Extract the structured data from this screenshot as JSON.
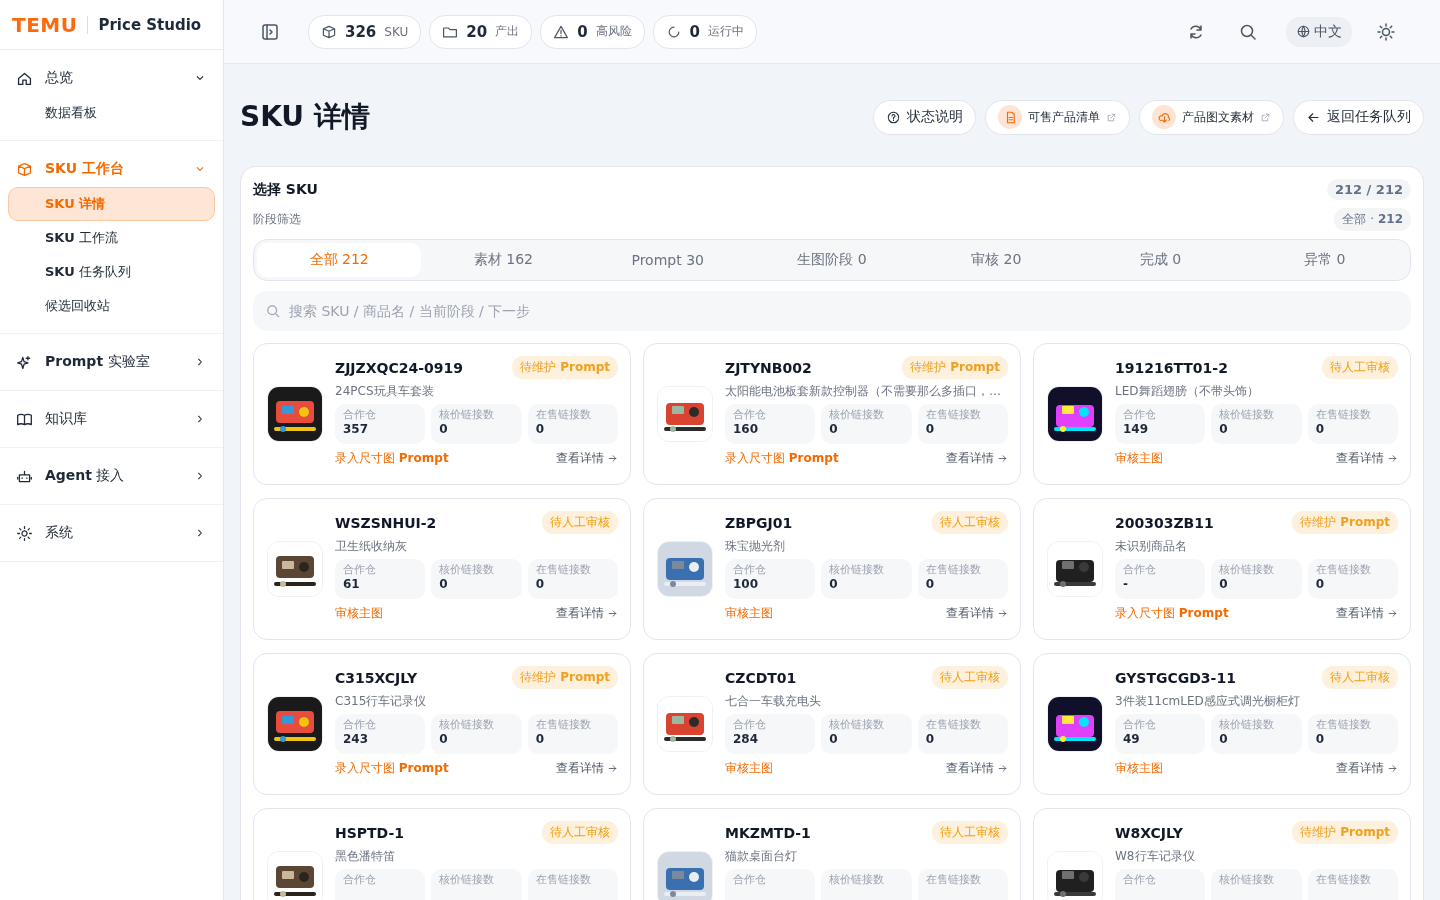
{
  "brand": {
    "logo": "TEMU",
    "product": "Price Studio"
  },
  "sidebar": [
    {
      "label": "总览",
      "expanded": true,
      "selected": false,
      "children": [
        {
          "label": "数据看板",
          "selected": false
        }
      ]
    },
    {
      "label": "SKU 工作台",
      "expanded": true,
      "selected": true,
      "children": [
        {
          "label": "**SKU** 详情",
          "selected": true
        },
        {
          "label": "**SKU** 工作流",
          "selected": false
        },
        {
          "label": "**SKU** 任务队列",
          "selected": false
        },
        {
          "label": "候选回收站",
          "selected": false
        }
      ]
    },
    {
      "label": "**Prompt** 实验室",
      "expanded": false,
      "selected": false
    },
    {
      "label": "知识库",
      "expanded": false,
      "selected": false
    },
    {
      "label": "**Agent** 接入",
      "expanded": false,
      "selected": false
    },
    {
      "label": "系统",
      "expanded": false,
      "selected": false
    }
  ],
  "topbar": {
    "stats": [
      {
        "value": "326",
        "label": "SKU"
      },
      {
        "value": "20",
        "label": "产出"
      },
      {
        "value": "0",
        "label": "高风险"
      },
      {
        "value": "0",
        "label": "运行中"
      }
    ],
    "language": "中文"
  },
  "page": {
    "title": "SKU 详情",
    "actions": [
      {
        "label": "状态说明",
        "external": false
      },
      {
        "label": "可售产品清单",
        "external": true
      },
      {
        "label": "产品图文素材",
        "external": true
      },
      {
        "label": "返回任务队列",
        "external": false
      }
    ]
  },
  "panel": {
    "title": "选择 SKU",
    "count": "212 / 212",
    "filter_label": "阶段筛选",
    "filter_summary": "全部 · **212**",
    "tabs": [
      {
        "label": "全部 212",
        "selected": true
      },
      {
        "label": "素材 162",
        "selected": false
      },
      {
        "label": "Prompt 30",
        "selected": false
      },
      {
        "label": "生图阶段 0",
        "selected": false
      },
      {
        "label": "审核 20",
        "selected": false
      },
      {
        "label": "完成 0",
        "selected": false
      },
      {
        "label": "异常 0",
        "selected": false
      }
    ],
    "search": {
      "placeholder": "搜索 SKU / 商品名 / 当前阶段 / 下一步"
    },
    "cards": [
      {
        "sku": "ZJJZXQC24-0919",
        "name": "24PCS玩具车套装",
        "badge": {
          "kind": "prompt",
          "text": "待维护 **Prompt**"
        },
        "stats": [
          {
            "label": "合作仓",
            "value": "357"
          },
          {
            "label": "核价链接数",
            "value": "0"
          },
          {
            "label": "在售链接数",
            "value": "0"
          }
        ],
        "next": "录入尺寸图 **Prompt**",
        "link": "查看详情"
      },
      {
        "sku": "ZJTYNB002",
        "name": "太阳能电池板套新款控制器（不需要那么多插口，…",
        "badge": {
          "kind": "prompt",
          "text": "待维护 **Prompt**"
        },
        "stats": [
          {
            "label": "合作仓",
            "value": "160"
          },
          {
            "label": "核价链接数",
            "value": "0"
          },
          {
            "label": "在售链接数",
            "value": "0"
          }
        ],
        "next": "录入尺寸图 **Prompt**",
        "link": "查看详情"
      },
      {
        "sku": "191216TT01-2",
        "name": "LED舞蹈翅膀（不带头饰）",
        "badge": {
          "kind": "review",
          "text": "待人工审核"
        },
        "stats": [
          {
            "label": "合作仓",
            "value": "149"
          },
          {
            "label": "核价链接数",
            "value": "0"
          },
          {
            "label": "在售链接数",
            "value": "0"
          }
        ],
        "next": "审核主图",
        "link": "查看详情"
      },
      {
        "sku": "WSZSNHUI-2",
        "name": "卫生纸收纳灰",
        "badge": {
          "kind": "review",
          "text": "待人工审核"
        },
        "stats": [
          {
            "label": "合作仓",
            "value": "61"
          },
          {
            "label": "核价链接数",
            "value": "0"
          },
          {
            "label": "在售链接数",
            "value": "0"
          }
        ],
        "next": "审核主图",
        "link": "查看详情"
      },
      {
        "sku": "ZBPGJ01",
        "name": "珠宝抛光剂",
        "badge": {
          "kind": "review",
          "text": "待人工审核"
        },
        "stats": [
          {
            "label": "合作仓",
            "value": "100"
          },
          {
            "label": "核价链接数",
            "value": "0"
          },
          {
            "label": "在售链接数",
            "value": "0"
          }
        ],
        "next": "审核主图",
        "link": "查看详情"
      },
      {
        "sku": "200303ZB11",
        "name": "未识别商品名",
        "badge": {
          "kind": "prompt",
          "text": "待维护 **Prompt**"
        },
        "stats": [
          {
            "label": "合作仓",
            "value": "-"
          },
          {
            "label": "核价链接数",
            "value": "0"
          },
          {
            "label": "在售链接数",
            "value": "0"
          }
        ],
        "next": "录入尺寸图 **Prompt**",
        "link": "查看详情"
      },
      {
        "sku": "C315XCJLY",
        "name": "C315行车记录仪",
        "badge": {
          "kind": "prompt",
          "text": "待维护 **Prompt**"
        },
        "stats": [
          {
            "label": "合作仓",
            "value": "243"
          },
          {
            "label": "核价链接数",
            "value": "0"
          },
          {
            "label": "在售链接数",
            "value": "0"
          }
        ],
        "next": "录入尺寸图 **Prompt**",
        "link": "查看详情"
      },
      {
        "sku": "CZCDT01",
        "name": "七合一车载充电头",
        "badge": {
          "kind": "review",
          "text": "待人工审核"
        },
        "stats": [
          {
            "label": "合作仓",
            "value": "284"
          },
          {
            "label": "核价链接数",
            "value": "0"
          },
          {
            "label": "在售链接数",
            "value": "0"
          }
        ],
        "next": "审核主图",
        "link": "查看详情"
      },
      {
        "sku": "GYSTGCGD3-11",
        "name": "3件装11cmLED感应式调光橱柜灯",
        "badge": {
          "kind": "review",
          "text": "待人工审核"
        },
        "stats": [
          {
            "label": "合作仓",
            "value": "49"
          },
          {
            "label": "核价链接数",
            "value": "0"
          },
          {
            "label": "在售链接数",
            "value": "0"
          }
        ],
        "next": "审核主图",
        "link": "查看详情"
      },
      {
        "sku": "HSPTD-1",
        "name": "黑色潘特笛",
        "badge": {
          "kind": "review",
          "text": "待人工审核"
        },
        "stats": [
          {
            "label": "合作仓"
          },
          {
            "label": "核价链接数"
          },
          {
            "label": "在售链接数"
          }
        ]
      },
      {
        "sku": "MKZMTD-1",
        "name": "猫款桌面台灯",
        "badge": {
          "kind": "review",
          "text": "待人工审核"
        },
        "stats": [
          {
            "label": "合作仓"
          },
          {
            "label": "核价链接数"
          },
          {
            "label": "在售链接数"
          }
        ]
      },
      {
        "sku": "W8XCJLY",
        "name": "W8行车记录仪",
        "badge": {
          "kind": "prompt",
          "text": "待维护 **Prompt**"
        },
        "stats": [
          {
            "label": "合作仓"
          },
          {
            "label": "核价链接数"
          },
          {
            "label": "在售链接数"
          }
        ]
      }
    ]
  }
}
